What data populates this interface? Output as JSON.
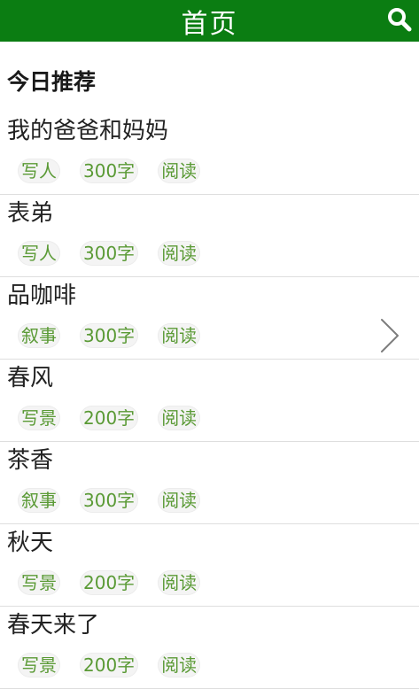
{
  "header": {
    "title": "首页",
    "search_icon": "search-icon"
  },
  "section": {
    "title": "今日推荐"
  },
  "articles": [
    {
      "title": "我的爸爸和妈妈",
      "tags": [
        "写人",
        "300字",
        "阅读"
      ]
    },
    {
      "title": "表弟",
      "tags": [
        "写人",
        "300字",
        "阅读"
      ]
    },
    {
      "title": "品咖啡",
      "tags": [
        "叙事",
        "300字",
        "阅读"
      ]
    },
    {
      "title": "春风",
      "tags": [
        "写景",
        "200字",
        "阅读"
      ]
    },
    {
      "title": "茶香",
      "tags": [
        "叙事",
        "300字",
        "阅读"
      ]
    },
    {
      "title": "秋天",
      "tags": [
        "写景",
        "200字",
        "阅读"
      ]
    },
    {
      "title": "春天来了",
      "tags": [
        "写景",
        "200字",
        "阅读"
      ]
    }
  ],
  "pager": {
    "next_icon": "chevron-right-icon"
  },
  "colors": {
    "header_bg": "#0b7d12",
    "tag_text": "#5a9a35",
    "tag_bg": "#f4f4f4"
  }
}
